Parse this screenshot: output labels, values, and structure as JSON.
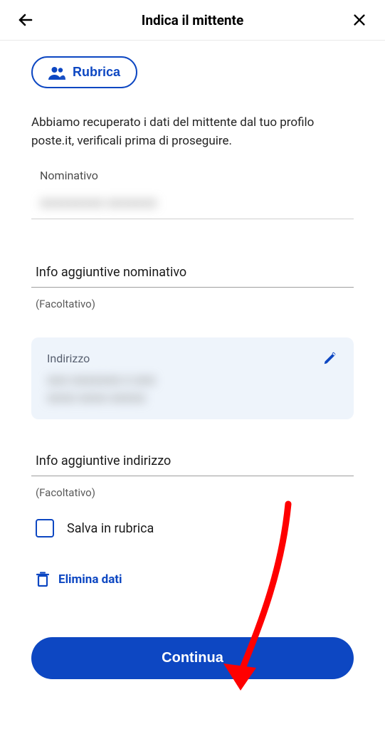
{
  "header": {
    "title": "Indica il mittente"
  },
  "rubrica_button": "Rubrica",
  "info_text": "Abbiamo recuperato i dati del mittente dal tuo profilo poste.it, verificali prima di proseguire.",
  "nominativo": {
    "label": "Nominativo",
    "value_redacted": "XXXXXXXXX XXXXXXX"
  },
  "info_agg_nominativo": {
    "placeholder": "Info aggiuntive nominativo",
    "hint": "(Facoltativo)"
  },
  "indirizzo": {
    "label": "Indirizzo",
    "line1_redacted": "XXX XXXXXXX X XXX",
    "line2_redacted": "XXXX XXXX  XXXXX"
  },
  "info_agg_indirizzo": {
    "placeholder": "Info aggiuntive indirizzo",
    "hint": "(Facoltativo)"
  },
  "save_contact_label": "Salva in rubrica",
  "delete_data_label": "Elimina dati",
  "continue_label": "Continua"
}
